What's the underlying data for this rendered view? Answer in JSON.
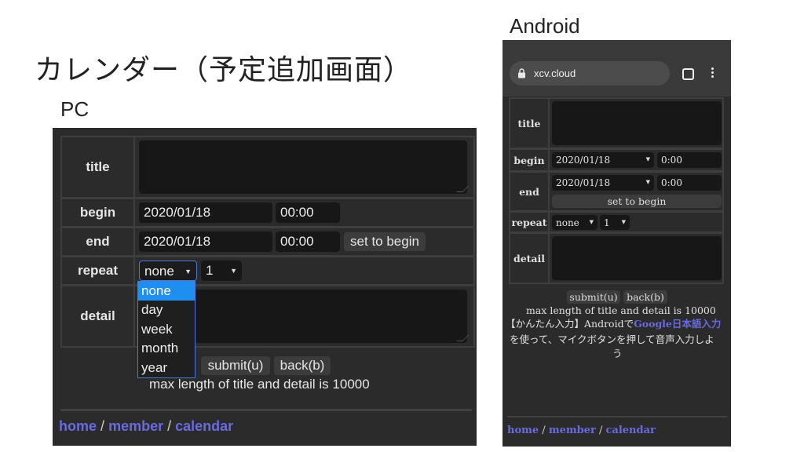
{
  "slide": {
    "title": "カレンダー（予定追加画面）",
    "pc_label": "PC",
    "android_label": "Android"
  },
  "pc": {
    "labels": {
      "title": "title",
      "begin": "begin",
      "end": "end",
      "repeat": "repeat",
      "detail": "detail"
    },
    "begin_date": "2020/01/18",
    "begin_time": "00:00",
    "end_date": "2020/01/18",
    "end_time": "00:00",
    "set_to_begin": "set to begin",
    "repeat_value": "none",
    "repeat_count": "1",
    "dropdown_options": [
      "none",
      "day",
      "week",
      "month",
      "year"
    ],
    "submit": "submit(u)",
    "back": "back(b)",
    "note": "max length of title and detail is 10000",
    "nav": {
      "home": "home",
      "member": "member",
      "calendar": "calendar",
      "sep": "/"
    }
  },
  "android": {
    "url": "xcv.cloud",
    "labels": {
      "title": "title",
      "begin": "begin",
      "end": "end",
      "repeat": "repeat",
      "detail": "detail"
    },
    "begin_date": "2020/01/18",
    "begin_time": "0:00",
    "end_date": "2020/01/18",
    "end_time": "0:00",
    "set_to_begin": "set to begin",
    "repeat_value": "none",
    "repeat_count": "1",
    "submit": "submit(u)",
    "back": "back(b)",
    "note": "max length of title and detail is 10000",
    "hint_pre": "【かんたん入力】Androidで",
    "hint_link": "Google日本語入力",
    "hint_line2": "を使って、マイクボタンを押して音声入力しよ",
    "hint_line3": "う",
    "nav": {
      "home": "home",
      "member": "member",
      "calendar": "calendar",
      "sep": "/"
    }
  },
  "colors": {
    "link": "#6a6ae0",
    "selected": "#1e8ef0",
    "panel": "#2b2b2b"
  }
}
